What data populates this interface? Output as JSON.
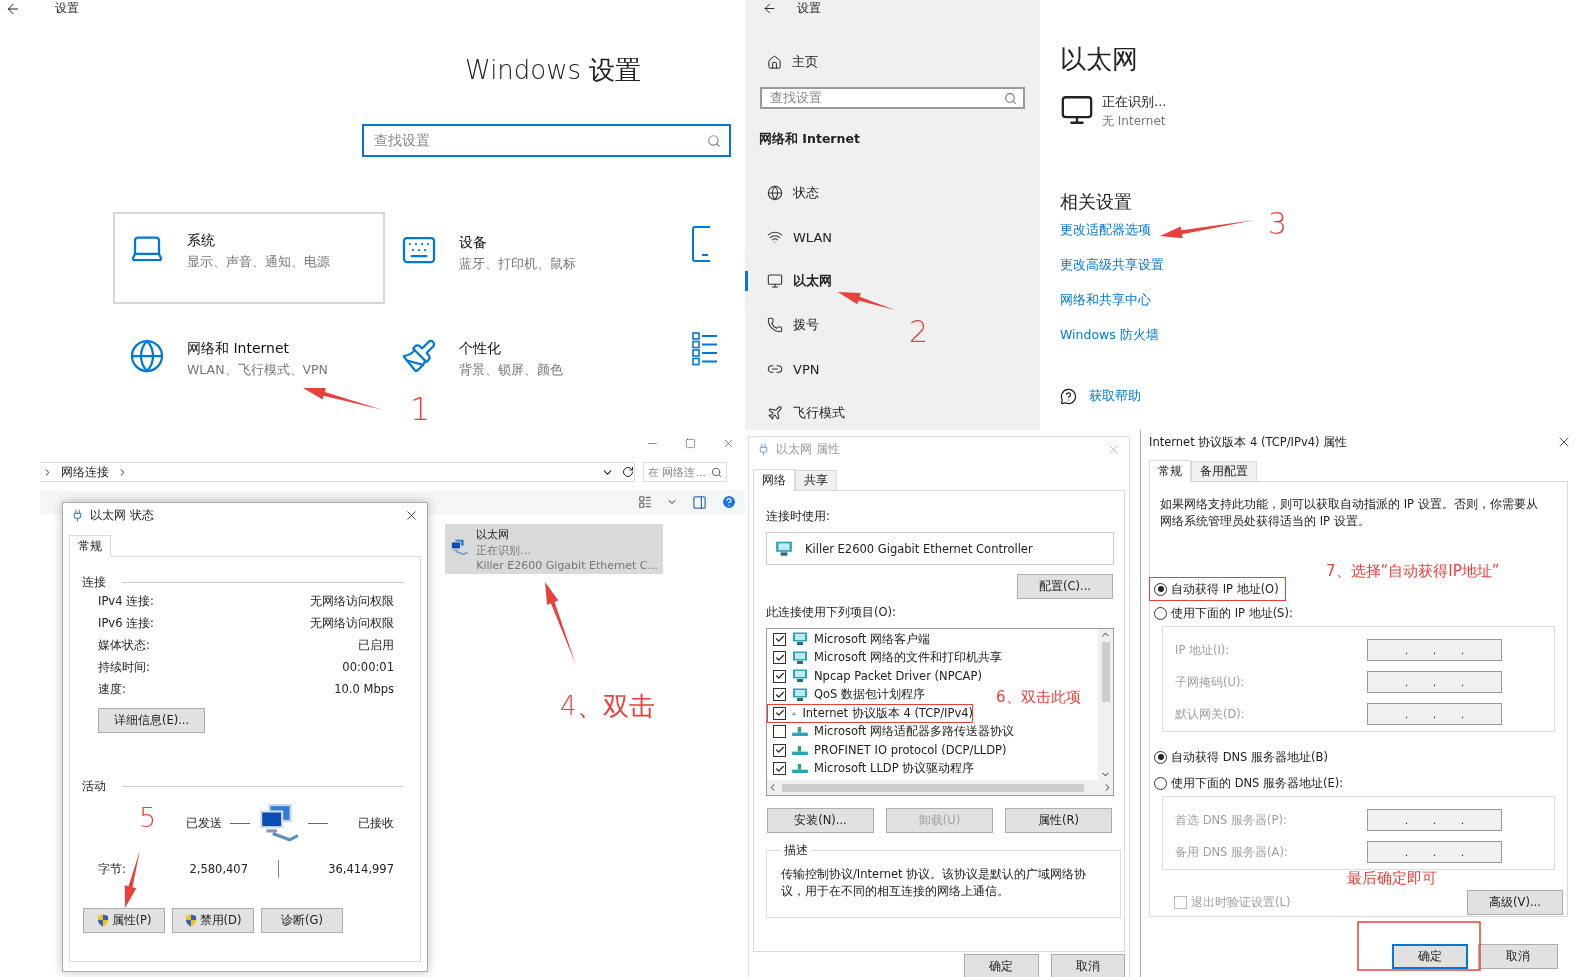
{
  "settings_home": {
    "title": "设置",
    "heading": "Windows 设置",
    "search": {
      "placeholder": "查找设置"
    },
    "tiles": [
      {
        "kind": "system",
        "title": "系统",
        "subtitle": "显示、声音、通知、电源",
        "selected": true
      },
      {
        "kind": "devices",
        "title": "设备",
        "subtitle": "蓝牙、打印机、鼠标",
        "selected": false
      },
      {
        "kind": "network",
        "title": "网络和 Internet",
        "subtitle": "WLAN、飞行模式、VPN",
        "selected": false
      },
      {
        "kind": "personalize",
        "title": "个性化",
        "subtitle": "背景、锁屏、颜色",
        "selected": false
      }
    ]
  },
  "network_settings": {
    "title": "设置",
    "home": "主页",
    "search": {
      "placeholder": "查找设置"
    },
    "section": "网络和 Internet",
    "nav": [
      {
        "kind": "status",
        "label": "状态",
        "selected": false
      },
      {
        "kind": "wlan",
        "label": "WLAN",
        "selected": false
      },
      {
        "kind": "ethernet",
        "label": "以太网",
        "selected": true
      },
      {
        "kind": "dialup",
        "label": "拨号",
        "selected": false
      },
      {
        "kind": "vpn",
        "label": "VPN",
        "selected": false
      },
      {
        "kind": "airplane",
        "label": "飞行模式",
        "selected": false
      }
    ],
    "page_title": "以太网",
    "connection": {
      "name": "正在识别...",
      "status": "无 Internet"
    },
    "related_heading": "相关设置",
    "links": [
      "更改适配器选项",
      "更改高级共享设置",
      "网络和共享中心",
      "Windows 防火墙"
    ],
    "help": "获取帮助"
  },
  "explorer": {
    "breadcrumb": "网络连接",
    "search": {
      "placeholder": "在 网络连..."
    },
    "adapter": {
      "name": "以太网",
      "status": "正在识别...",
      "device": "Killer E2600 Gigabit Ethernet C...",
      "selected": true
    }
  },
  "status_dialog": {
    "title": "以太网 状态",
    "tabs": [
      {
        "label": "常规",
        "selected": true
      }
    ],
    "connection_heading": "连接",
    "rows": [
      {
        "label": "IPv4 连接:",
        "value": "无网络访问权限"
      },
      {
        "label": "IPv6 连接:",
        "value": "无网络访问权限"
      },
      {
        "label": "媒体状态:",
        "value": "已启用"
      },
      {
        "label": "持续时间:",
        "value": "00:00:01"
      },
      {
        "label": "速度:",
        "value": "10.0 Mbps"
      }
    ],
    "details_button": "详细信息(E)...",
    "activity_heading": "活动",
    "sent_label": "已发送",
    "received_label": "已接收",
    "bytes_label": "字节:",
    "bytes_sent": "2,580,407",
    "bytes_received": "36,414,997",
    "buttons": [
      {
        "label": "属性(P)",
        "shield": true
      },
      {
        "label": "禁用(D)",
        "shield": true
      },
      {
        "label": "诊断(G)",
        "shield": false
      }
    ]
  },
  "properties_dialog": {
    "title": "以太网 属性",
    "tabs": [
      {
        "label": "网络",
        "selected": true
      },
      {
        "label": "共享",
        "selected": false
      }
    ],
    "connect_using_label": "连接时使用:",
    "adapter": "Killer E2600 Gigabit Ethernet Controller",
    "configure_button": "配置(C)...",
    "items_label": "此连接使用下列项目(O):",
    "items": [
      {
        "kind": "client",
        "label": "Microsoft 网络客户端",
        "checked": true,
        "highlighted": false
      },
      {
        "kind": "client",
        "label": "Microsoft 网络的文件和打印机共享",
        "checked": true,
        "highlighted": false
      },
      {
        "kind": "client",
        "label": "Npcap Packet Driver (NPCAP)",
        "checked": true,
        "highlighted": false
      },
      {
        "kind": "client",
        "label": "QoS 数据包计划程序",
        "checked": true,
        "highlighted": false
      },
      {
        "kind": "protocol",
        "label": "Internet 协议版本 4 (TCP/IPv4)",
        "checked": true,
        "highlighted": true
      },
      {
        "kind": "protocol",
        "label": "Microsoft 网络适配器多路传送器协议",
        "checked": false,
        "highlighted": false
      },
      {
        "kind": "protocol",
        "label": "PROFINET IO protocol (DCP/LLDP)",
        "checked": true,
        "highlighted": false
      },
      {
        "kind": "protocol",
        "label": "Microsoft LLDP 协议驱动程序",
        "checked": true,
        "highlighted": false
      }
    ],
    "buttons": [
      {
        "label": "安装(N)...",
        "disabled": false
      },
      {
        "label": "卸载(U)",
        "disabled": true
      },
      {
        "label": "属性(R)",
        "disabled": false
      }
    ],
    "description_label": "描述",
    "description": "传输控制协议/Internet 协议。该协议是默认的广域网络协议，用于在不同的相互连接的网络上通信。",
    "footer_buttons": [
      "确定",
      "取消"
    ]
  },
  "ipv4_dialog": {
    "title": "Internet 协议版本 4 (TCP/IPv4) 属性",
    "tabs": [
      {
        "label": "常规",
        "selected": true
      },
      {
        "label": "备用配置",
        "selected": false
      }
    ],
    "intro": "如果网络支持此功能，则可以获取自动指派的 IP 设置。否则，你需要从网络系统管理员处获得适当的 IP 设置。",
    "ip_options": [
      {
        "label": "自动获得 IP 地址(O)",
        "selected": true,
        "highlighted": true
      },
      {
        "label": "使用下面的 IP 地址(S):",
        "selected": false,
        "highlighted": false
      }
    ],
    "ip_fields": [
      {
        "label": "IP 地址(I):",
        "value": ".       .       .",
        "disabled": true
      },
      {
        "label": "子网掩码(U):",
        "value": ".       .       .",
        "disabled": true
      },
      {
        "label": "默认网关(D):",
        "value": ".       .       .",
        "disabled": true
      }
    ],
    "dns_options": [
      {
        "label": "自动获得 DNS 服务器地址(B)",
        "selected": true,
        "highlighted": false
      },
      {
        "label": "使用下面的 DNS 服务器地址(E):",
        "selected": false,
        "highlighted": false
      }
    ],
    "dns_fields": [
      {
        "label": "首选 DNS 服务器(P):",
        "value": ".       .       .",
        "disabled": true
      },
      {
        "label": "备用 DNS 服务器(A):",
        "value": ".       .       .",
        "disabled": true
      }
    ],
    "validate_checkbox": {
      "label": "退出时验证设置(L)",
      "checked": false,
      "disabled": true
    },
    "advanced_button": "高级(V)...",
    "ok_button": {
      "label": "确定",
      "highlighted": true
    },
    "cancel_button": "取消"
  },
  "annotations": [
    {
      "text": "1"
    },
    {
      "text": "2"
    },
    {
      "text": "3"
    },
    {
      "text": "4、双击"
    },
    {
      "text": "5"
    },
    {
      "text": "6、双击此项"
    },
    {
      "text": "7、选择“自动获得IP地址”"
    },
    {
      "text": "最后确定即可"
    }
  ]
}
